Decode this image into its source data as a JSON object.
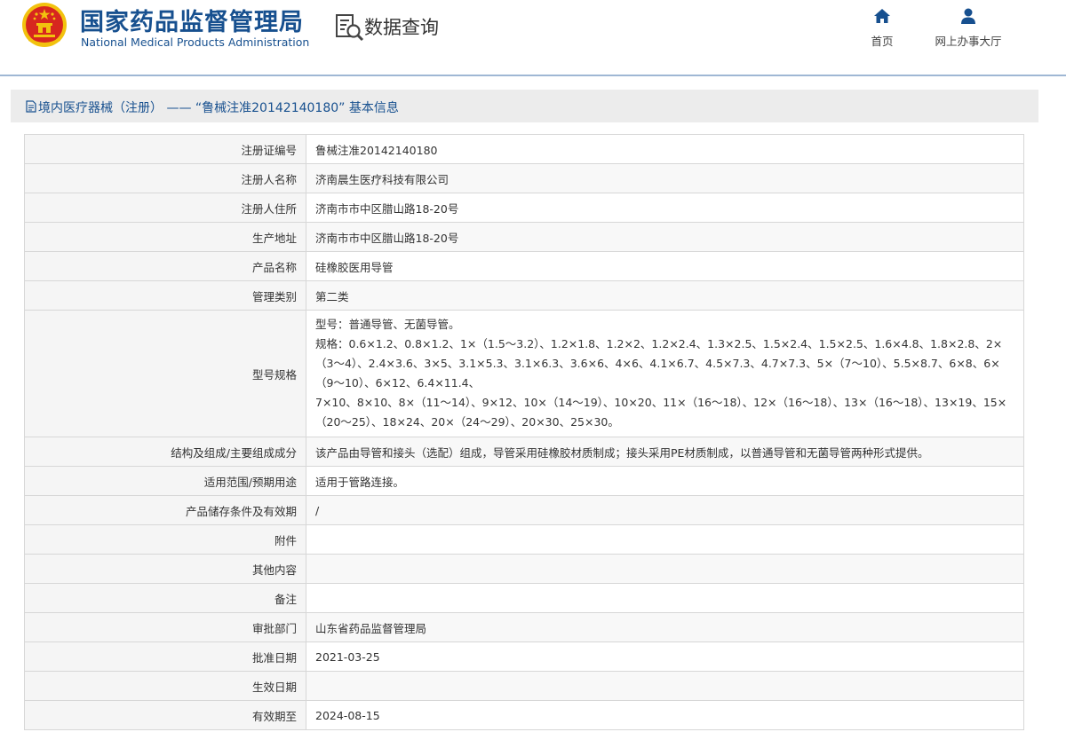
{
  "header": {
    "title_cn": "国家药品监督管理局",
    "title_en": "National Medical Products Administration",
    "query_title": "数据查询",
    "nav": [
      {
        "label": "首页",
        "icon": "home-icon"
      },
      {
        "label": "网上办事大厅",
        "icon": "user-icon"
      }
    ]
  },
  "panel": {
    "title": "境内医疗器械（注册） —— “鲁械注准20142140180” 基本信息"
  },
  "rows": [
    {
      "label": "注册证编号",
      "value": "鲁械注准20142140180"
    },
    {
      "label": "注册人名称",
      "value": "济南晨生医疗科技有限公司"
    },
    {
      "label": "注册人住所",
      "value": "济南市市中区腊山路18-20号"
    },
    {
      "label": "生产地址",
      "value": "济南市市中区腊山路18-20号"
    },
    {
      "label": "产品名称",
      "value": "硅橡胶医用导管"
    },
    {
      "label": "管理类别",
      "value": "第二类"
    },
    {
      "label": "型号规格",
      "lines": [
        "型号：普通导管、无菌导管。",
        "规格：0.6×1.2、0.8×1.2、1×（1.5～3.2）、1.2×1.8、1.2×2、1.2×2.4、1.3×2.5、1.5×2.4、1.5×2.5、1.6×4.8、1.8×2.8、2×（3～4）、2.4×3.6、3×5、3.1×5.3、3.1×6.3、3.6×6、4×6、4.1×6.7、4.5×7.3、4.7×7.3、5×（7～10）、5.5×8.7、6×8、6×（9～10）、6×12、6.4×11.4、",
        "7×10、8×10、8×（11～14）、9×12、10×（14～19）、10×20、11×（16～18）、12×（16～18）、13×（16～18）、13×19、15×（20～25）、18×24、20×（24～29）、20×30、25×30。"
      ]
    },
    {
      "label": "结构及组成/主要组成成分",
      "value": "该产品由导管和接头（选配）组成，导管采用硅橡胶材质制成；接头采用PE材质制成，以普通导管和无菌导管两种形式提供。"
    },
    {
      "label": "适用范围/预期用途",
      "value": "适用于管路连接。"
    },
    {
      "label": "产品储存条件及有效期",
      "value": "/"
    },
    {
      "label": "附件",
      "value": ""
    },
    {
      "label": "其他内容",
      "value": ""
    },
    {
      "label": "备注",
      "value": ""
    },
    {
      "label": "审批部门",
      "value": "山东省药品监督管理局"
    },
    {
      "label": "批准日期",
      "value": "2021-03-25"
    },
    {
      "label": "生效日期",
      "value": ""
    },
    {
      "label": "有效期至",
      "value": "2024-08-15"
    }
  ],
  "colors": {
    "brand_blue": "#17508f",
    "emblem_red": "#d7261f",
    "emblem_gold": "#f2c20e",
    "border": "#d7d7d7",
    "label_bg": "#f5f5f5"
  }
}
